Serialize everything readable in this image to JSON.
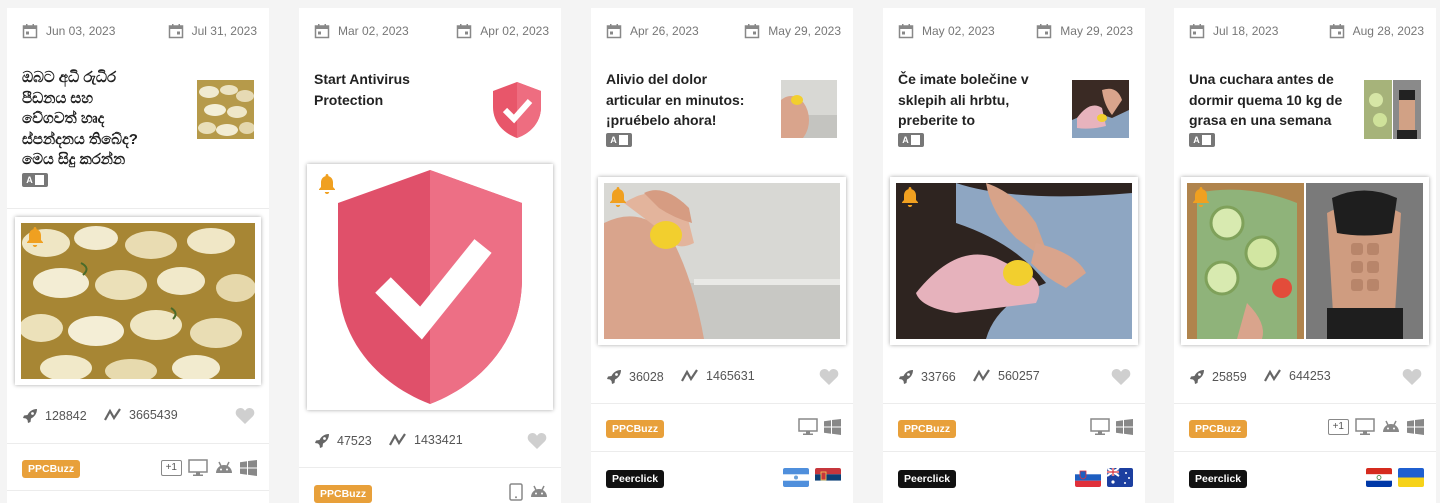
{
  "cards": [
    {
      "start_date": "Jun 03, 2023",
      "end_date": "Jul 31, 2023",
      "title_lines": [
        "ඔබට අධි රුධිර",
        "පීඩනය සහ",
        "වේගවත් හෘද",
        "ස්පන්දනය තිබේද?",
        "මෙය සිදු කරන්න"
      ],
      "shares": "128842",
      "impressions": "3665439",
      "network_label": "PPCBuzz",
      "plus_label": "+1",
      "devices": [
        "desktop-icon",
        "android-icon",
        "windows-icon"
      ]
    },
    {
      "start_date": "Mar 02, 2023",
      "end_date": "Apr 02, 2023",
      "title_lines": [
        "Start Antivirus",
        "Protection"
      ],
      "shares": "47523",
      "impressions": "1433421",
      "network_label": "PPCBuzz",
      "devices": [
        "tablet-icon",
        "android-icon"
      ]
    },
    {
      "start_date": "Apr 26, 2023",
      "end_date": "May 29, 2023",
      "title_lines": [
        "Alivio del dolor",
        "articular en minutos:",
        "¡pruébelo ahora!"
      ],
      "shares": "36028",
      "impressions": "1465631",
      "network_label": "PPCBuzz",
      "devices": [
        "desktop-icon",
        "windows-icon"
      ],
      "network2_label": "Peerclick",
      "flags": [
        "flag-nicaragua",
        "flag-serbia"
      ]
    },
    {
      "start_date": "May 02, 2023",
      "end_date": "May 29, 2023",
      "title_lines": [
        "Če imate bolečine v",
        "sklepih ali hrbtu,",
        "preberite to"
      ],
      "shares": "33766",
      "impressions": "560257",
      "network_label": "PPCBuzz",
      "devices": [
        "desktop-icon",
        "windows-icon"
      ],
      "network2_label": "Peerclick",
      "flags": [
        "flag-slovenia",
        "flag-australia"
      ]
    },
    {
      "start_date": "Jul 18, 2023",
      "end_date": "Aug 28, 2023",
      "title_lines": [
        "Una cuchara antes de",
        "dormir quema 10 kg de",
        "grasa en una semana"
      ],
      "shares": "25859",
      "impressions": "644253",
      "network_label": "PPCBuzz",
      "plus_label": "+1",
      "devices": [
        "desktop-icon",
        "android-icon",
        "windows-icon"
      ],
      "network2_label": "Peerclick",
      "flags": [
        "flag-paraguay",
        "flag-ukraine"
      ]
    }
  ],
  "colors": {
    "accent_orange": "#e8a03a",
    "bell_orange": "#f0a020",
    "shield_red": "#e8566a",
    "text_dark": "#222222",
    "text_muted": "#777777",
    "icon_grey": "#cccccc"
  }
}
